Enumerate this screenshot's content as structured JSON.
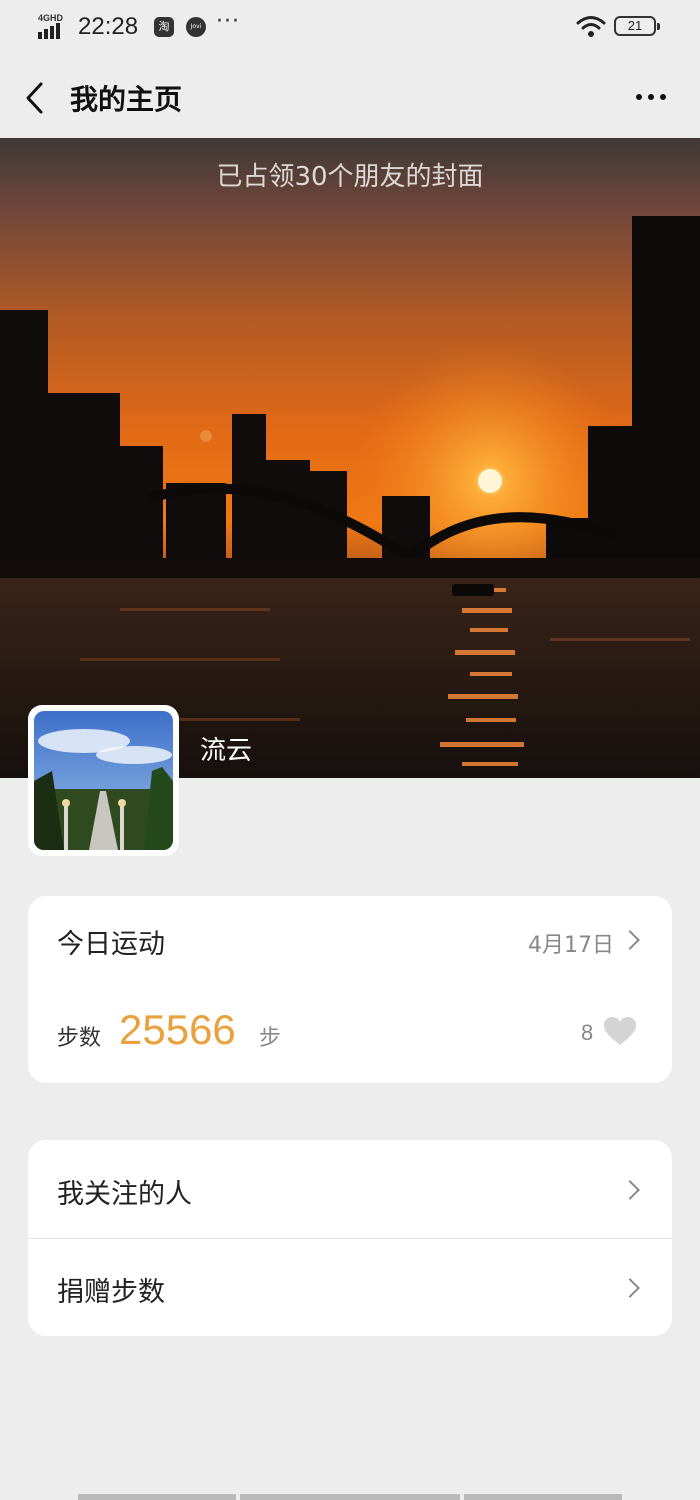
{
  "status_bar": {
    "network": "4GHD",
    "time": "22:28",
    "app1": "淘",
    "app2": "Jovi",
    "more": "···",
    "battery": "21"
  },
  "nav": {
    "title": "我的主页"
  },
  "cover": {
    "caption": "已占领30个朋友的封面",
    "username": "流云"
  },
  "sport_card": {
    "title": "今日运动",
    "date": "4月17日",
    "steps_label": "步数",
    "steps_value": "25566",
    "steps_unit": "步",
    "likes": "8"
  },
  "menu": {
    "items": [
      {
        "label": "我关注的人"
      },
      {
        "label": "捐赠步数"
      }
    ]
  },
  "colors": {
    "steps_accent": "#e9a13b",
    "background": "#ededed"
  },
  "icons": [
    "back-arrow-icon",
    "more-dots-icon",
    "wifi-icon",
    "battery-icon",
    "chevron-right-icon",
    "heart-icon"
  ]
}
